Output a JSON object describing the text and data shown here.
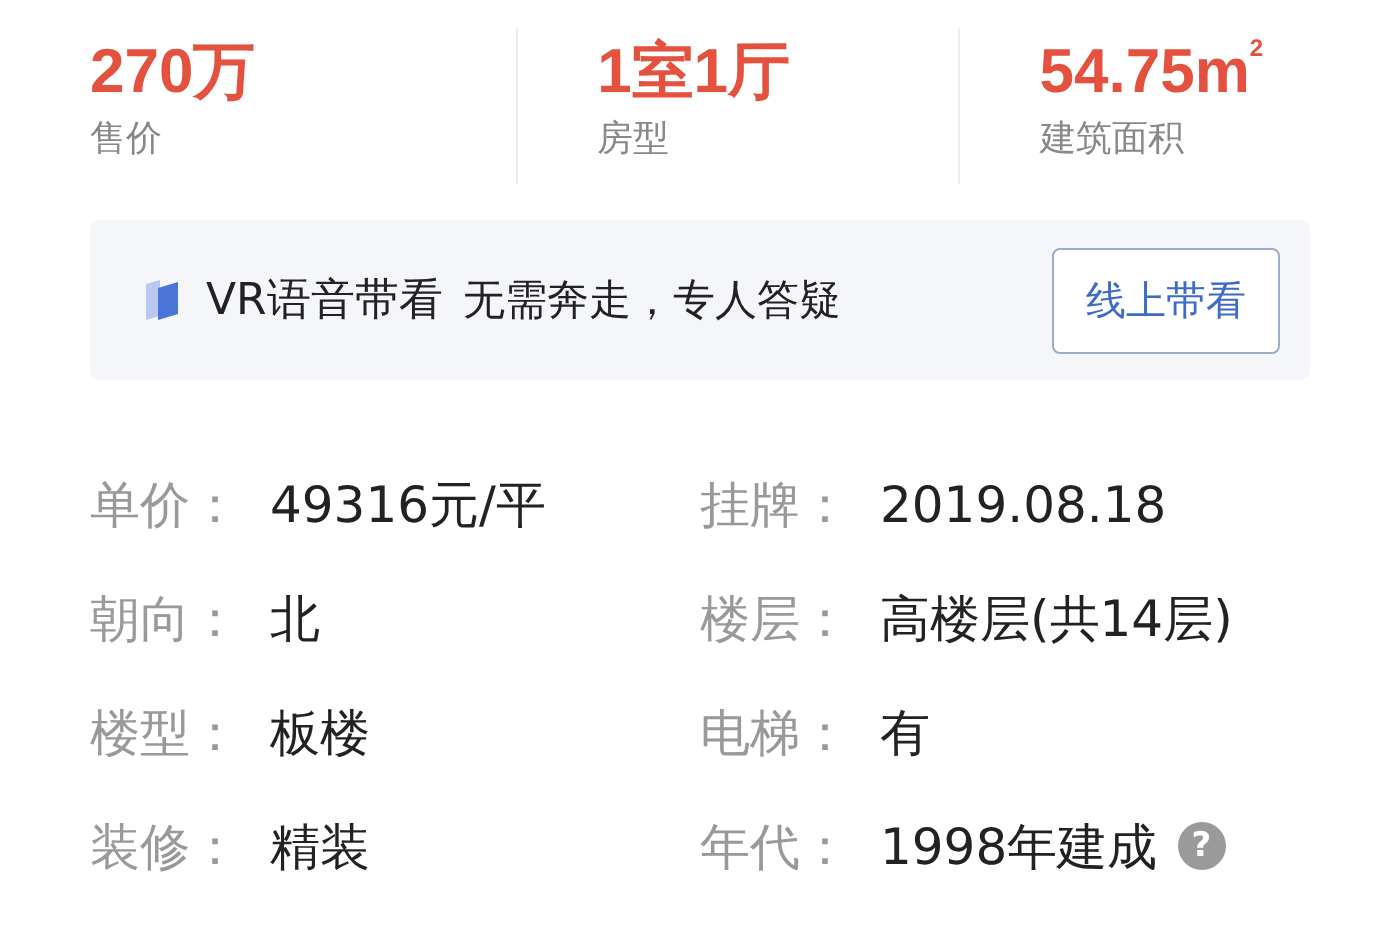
{
  "stats": [
    {
      "value": "270万",
      "label": "售价"
    },
    {
      "value": "1室1厅",
      "label": "房型"
    },
    {
      "value": "54.75m$^{2}$",
      "label": "建筑面积"
    }
  ],
  "vr_banner": {
    "title": "VR语音带看",
    "subtitle": "无需奔走，专人答疑",
    "button": "线上带看"
  },
  "details": [
    {
      "label": "单价：",
      "value": "49316元/平"
    },
    {
      "label": "挂牌：",
      "value": "2019.08.18"
    },
    {
      "label": "朝向：",
      "value": "北"
    },
    {
      "label": "楼层：",
      "value": "高楼层(共14层)"
    },
    {
      "label": "楼型：",
      "value": "板楼"
    },
    {
      "label": "电梯：",
      "value": "有"
    },
    {
      "label": "装修：",
      "value": "精装"
    },
    {
      "label": "年代：",
      "value": "1998年建成",
      "help": "?"
    }
  ]
}
